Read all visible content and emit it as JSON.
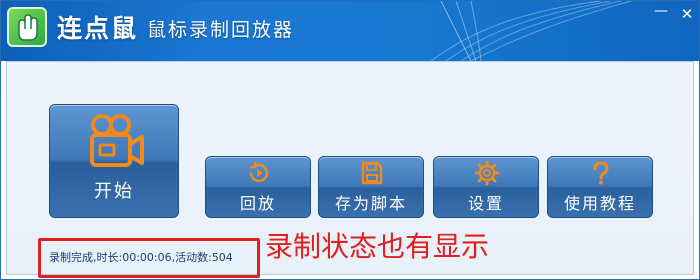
{
  "titlebar": {
    "brand": "连点鼠",
    "subtitle": "鼠标录制回放器",
    "minimize_glyph": "—",
    "close_glyph": "✕"
  },
  "buttons": {
    "start": {
      "label": "开始",
      "icon": "video-camera-icon"
    },
    "replay": {
      "label": "回放",
      "icon": "replay-icon"
    },
    "save_script": {
      "label": "存为脚本",
      "icon": "save-icon"
    },
    "settings": {
      "label": "设置",
      "icon": "gear-icon"
    },
    "tutorial": {
      "label": "使用教程",
      "icon": "help-icon"
    }
  },
  "status": {
    "text": "录制完成,时长:00:00:06,活动数:504"
  },
  "annotation": {
    "text": "录制状态也有显示"
  },
  "colors": {
    "titlebar": "#1778d0",
    "button": "#3f78b8",
    "icon_accent": "#f08a1c",
    "annotation_red": "#e02020"
  }
}
